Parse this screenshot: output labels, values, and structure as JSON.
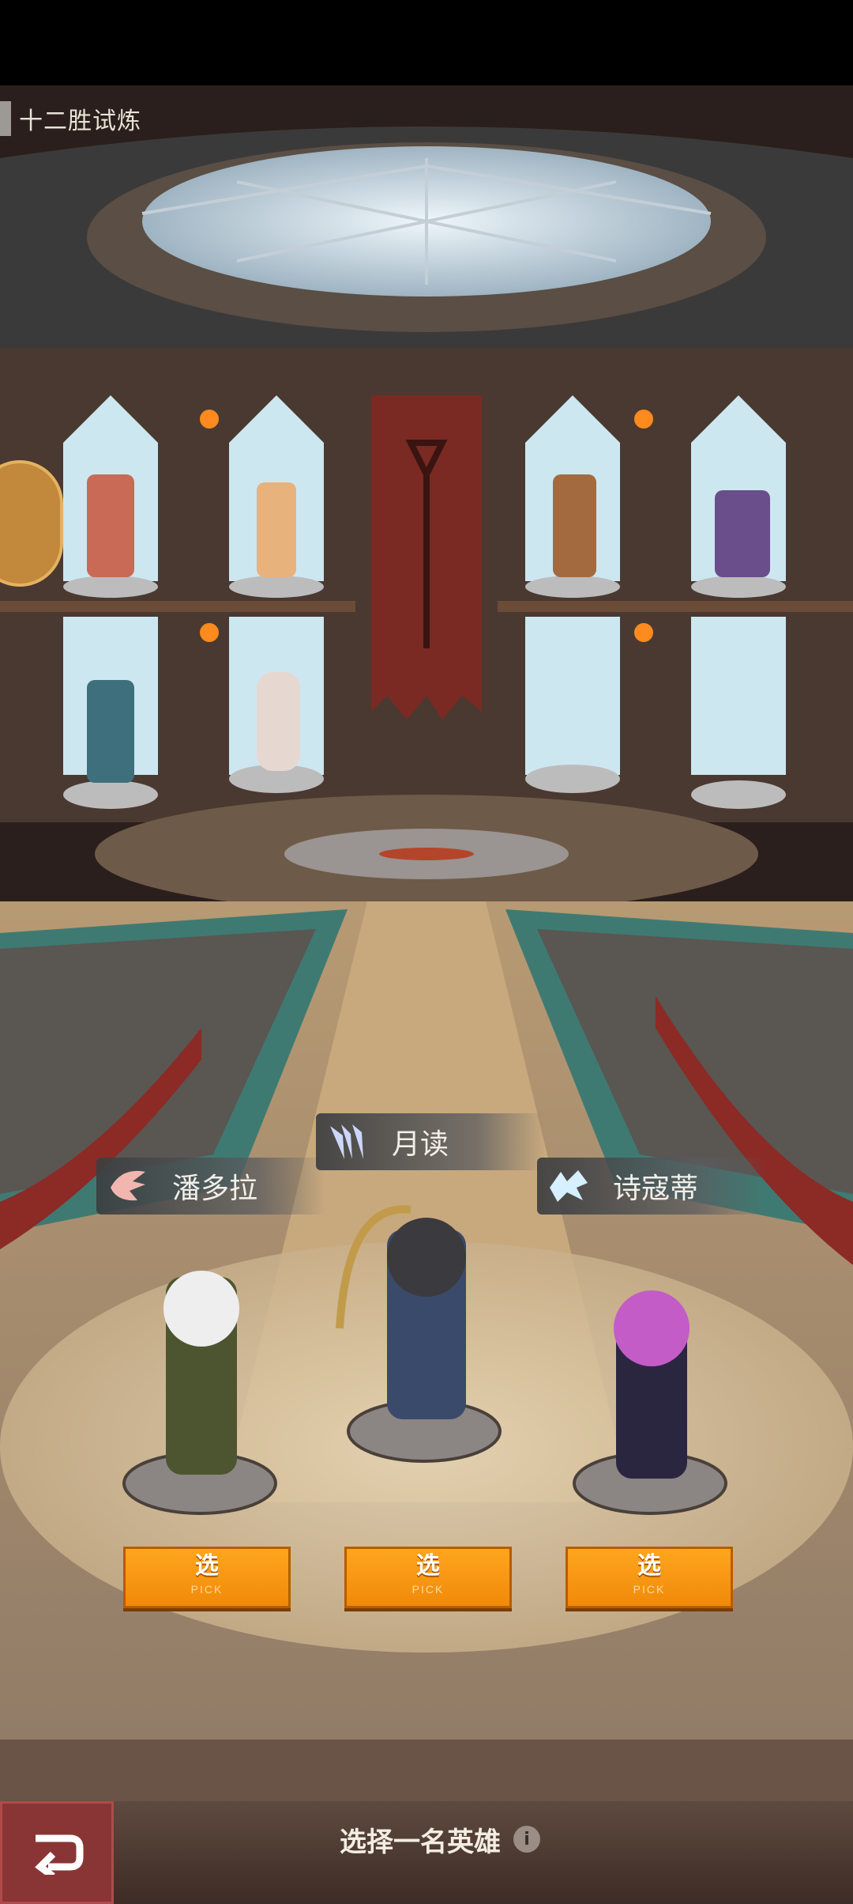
{
  "title": "十二胜试炼",
  "heroes": [
    {
      "name": "潘多拉",
      "emblem": "claw-emblem-icon",
      "emblem_color": "#f1b6b0"
    },
    {
      "name": "月读",
      "emblem": "wing-emblem-icon",
      "emblem_color": "#cdd6ff"
    },
    {
      "name": "诗寇蒂",
      "emblem": "wolf-emblem-icon",
      "emblem_color": "#d6f0ff"
    }
  ],
  "pick_button": {
    "label_zh": "选",
    "label_en": "PICK"
  },
  "footer": {
    "prompt": "选择一名英雄",
    "info_icon": "i"
  },
  "colors": {
    "accent": "#f5920e",
    "back_button": "#8a3535"
  }
}
